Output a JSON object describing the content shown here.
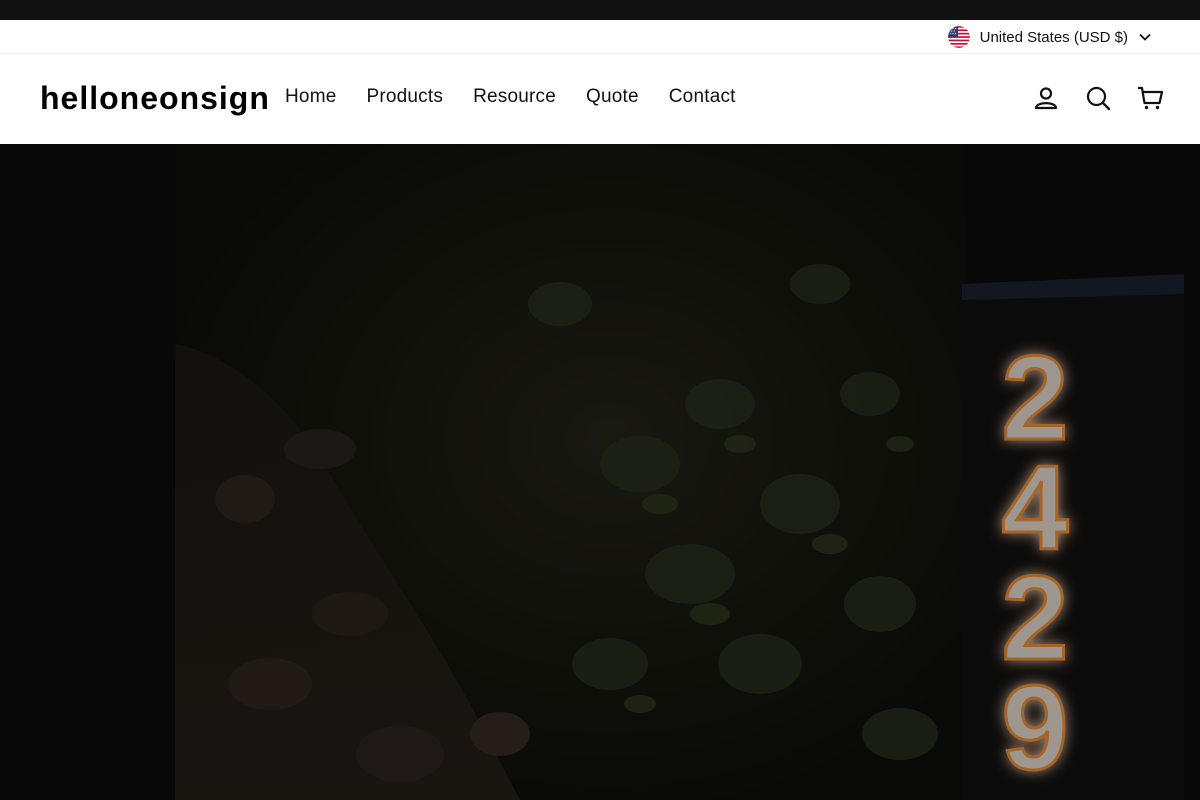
{
  "colors": {
    "topbar": "#111111",
    "header_bg": "#ffffff",
    "text": "#111111",
    "hero_overlay": "#0d0d0d",
    "neon_glow": "#ff9a3c"
  },
  "utility": {
    "currency_label": "United States (USD $)",
    "flag_icon": "us-flag-icon"
  },
  "header": {
    "logo": "helloneonsign",
    "nav": [
      {
        "label": "Home"
      },
      {
        "label": "Products"
      },
      {
        "label": "Resource"
      },
      {
        "label": "Quote"
      },
      {
        "label": "Contact"
      }
    ],
    "icons": [
      "account-icon",
      "search-icon",
      "cart-icon"
    ]
  },
  "hero": {
    "image": "dark-garden-photo-with-neon-house-number",
    "digits": [
      "2",
      "4",
      "2",
      "9"
    ]
  }
}
